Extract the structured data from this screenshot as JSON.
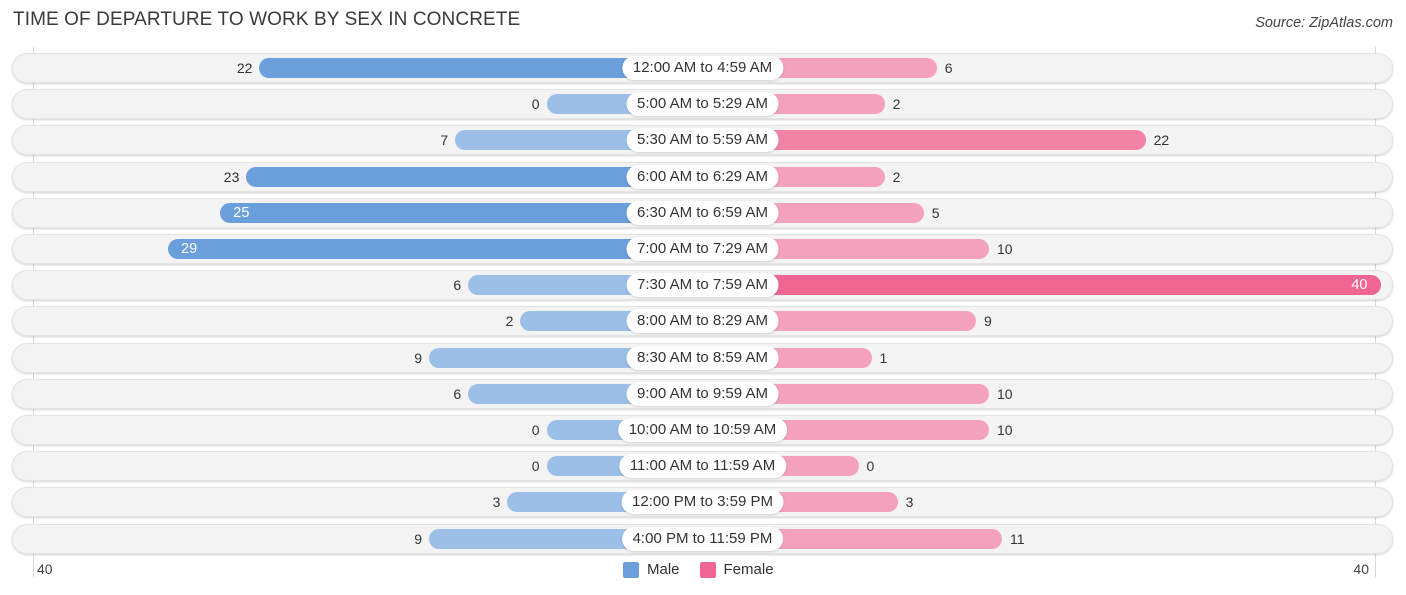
{
  "title": "TIME OF DEPARTURE TO WORK BY SEX IN CONCRETE",
  "source": "Source: ZipAtlas.com",
  "colors": {
    "male": "#6a9fdb",
    "male_light": "#9bbfe6",
    "female": "#f06591",
    "female_light": "#f4a1bd"
  },
  "chart_data": {
    "type": "bar",
    "orientation": "horizontal-diverging",
    "title": "TIME OF DEPARTURE TO WORK BY SEX IN CONCRETE",
    "categories": [
      "12:00 AM to 4:59 AM",
      "5:00 AM to 5:29 AM",
      "5:30 AM to 5:59 AM",
      "6:00 AM to 6:29 AM",
      "6:30 AM to 6:59 AM",
      "7:00 AM to 7:29 AM",
      "7:30 AM to 7:59 AM",
      "8:00 AM to 8:29 AM",
      "8:30 AM to 8:59 AM",
      "9:00 AM to 9:59 AM",
      "10:00 AM to 10:59 AM",
      "11:00 AM to 11:59 AM",
      "12:00 PM to 3:59 PM",
      "4:00 PM to 11:59 PM"
    ],
    "series": [
      {
        "name": "Male",
        "values": [
          22,
          0,
          7,
          23,
          25,
          29,
          6,
          2,
          9,
          6,
          0,
          0,
          3,
          9
        ]
      },
      {
        "name": "Female",
        "values": [
          6,
          2,
          22,
          2,
          5,
          10,
          40,
          9,
          1,
          10,
          10,
          0,
          3,
          11
        ]
      }
    ],
    "axis": {
      "left_tick": "40",
      "right_tick": "40",
      "range": [
        0,
        40
      ]
    },
    "legend": {
      "entries": [
        "Male",
        "Female"
      ],
      "placement": "bottom-center"
    }
  }
}
